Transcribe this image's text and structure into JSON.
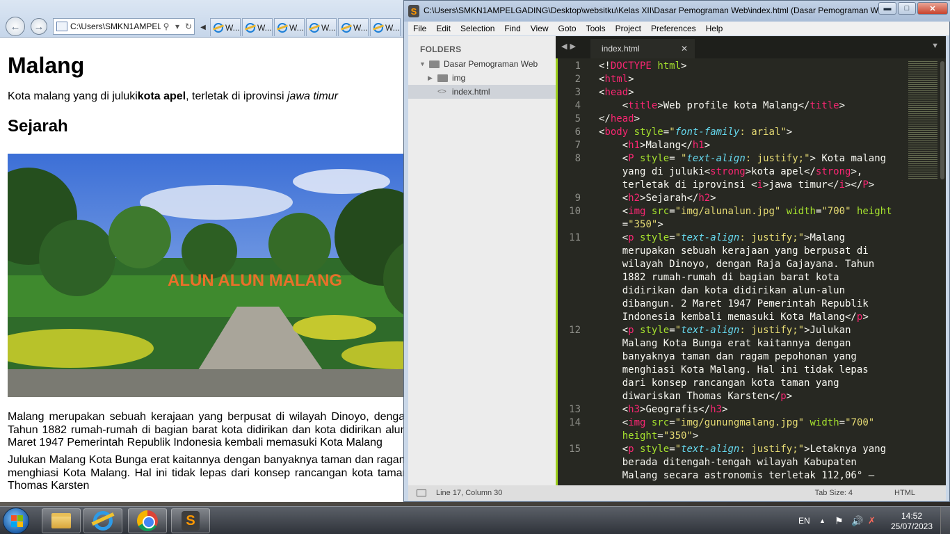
{
  "ie": {
    "address": "C:\\Users\\SMKN1AMPEL",
    "tabs": [
      "W...",
      "W...",
      "W...",
      "W...",
      "W...",
      "W..."
    ],
    "page": {
      "h1": "Malang",
      "intro_a": "Kota malang yang di juluki",
      "intro_strong": "kota apel",
      "intro_b": ", terletak di iprovinsi ",
      "intro_i": "jawa timur",
      "h2": "Sejarah",
      "photo_sign": "ALUN ALUN MALANG",
      "para1": "Malang merupakan sebuah kerajaan yang berpusat di wilayah Dinoyo, dengan Raja Gajayana. Tahun 1882 rumah-rumah di bagian barat kota didirikan dan kota didirikan alun-alun dibangun. 2 Maret 1947 Pemerintah Republik Indonesia kembali memasuki Kota Malang",
      "para2": "Julukan Malang Kota Bunga erat kaitannya dengan banyaknya taman dan ragam pepohonan yang menghiasi Kota Malang. Hal ini tidak lepas dari konsep rancangan kota taman yang diwariskan Thomas Karsten"
    }
  },
  "sublime": {
    "title": "C:\\Users\\SMKN1AMPELGADING\\Desktop\\websitku\\Kelas XII\\Dasar Pemograman Web\\index.html (Dasar Pemograman W...",
    "menu": [
      "File",
      "Edit",
      "Selection",
      "Find",
      "View",
      "Goto",
      "Tools",
      "Project",
      "Preferences",
      "Help"
    ],
    "sidebar": {
      "header": "FOLDERS",
      "root": "Dasar Pemograman Web",
      "folder": "img",
      "file": "index.html"
    },
    "tab": "index.html",
    "line_numbers": [
      "1",
      "2",
      "3",
      "4",
      "5",
      "6",
      "7",
      "8",
      "9",
      "10",
      "11",
      "12",
      "13",
      "14",
      "15"
    ],
    "status": {
      "position": "Line 17, Column 30",
      "tab_size": "Tab Size: 4",
      "syntax": "HTML"
    }
  },
  "taskbar": {
    "lang": "EN",
    "time": "14:52",
    "date": "25/07/2023"
  }
}
